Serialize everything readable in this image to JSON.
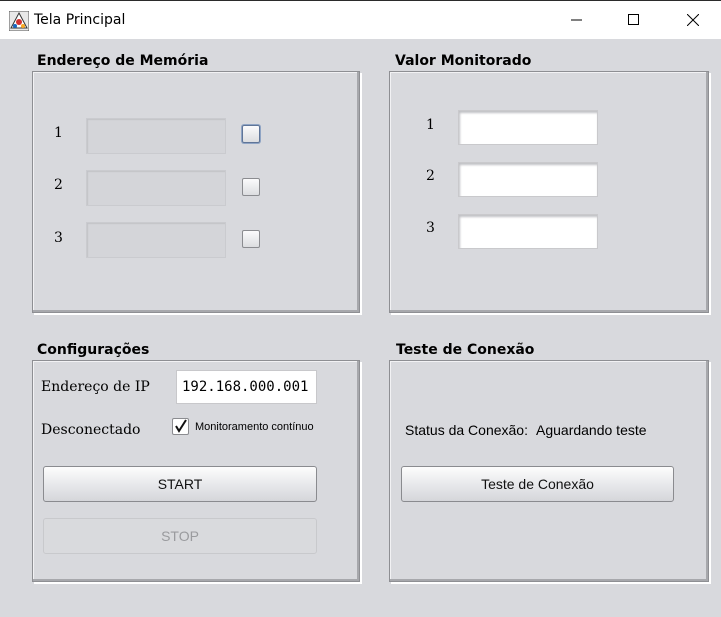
{
  "window": {
    "title": "Tela Principal",
    "controls": [
      "minimize",
      "maximize",
      "close"
    ]
  },
  "memory_panel": {
    "title": "Endereço de Memória",
    "rows": [
      {
        "label": "1",
        "value": "",
        "checked": false
      },
      {
        "label": "2",
        "value": "",
        "checked": false
      },
      {
        "label": "3",
        "value": "",
        "checked": false
      }
    ]
  },
  "monitor_panel": {
    "title": "Valor Monitorado",
    "rows": [
      {
        "label": "1",
        "value": ""
      },
      {
        "label": "2",
        "value": ""
      },
      {
        "label": "3",
        "value": ""
      }
    ]
  },
  "config_panel": {
    "title": "Configurações",
    "ip_label": "Endereço de IP",
    "ip_value": "192.168.000.001",
    "status": "Desconectado",
    "continuous_label": "Monitoramento contínuo",
    "continuous_checked": true,
    "start_label": "START",
    "stop_label": "STOP"
  },
  "connection_panel": {
    "title": "Teste de Conexão",
    "status_label": "Status da Conexão:",
    "status_value": "Aguardando teste",
    "test_button_label": "Teste de Conexão"
  }
}
